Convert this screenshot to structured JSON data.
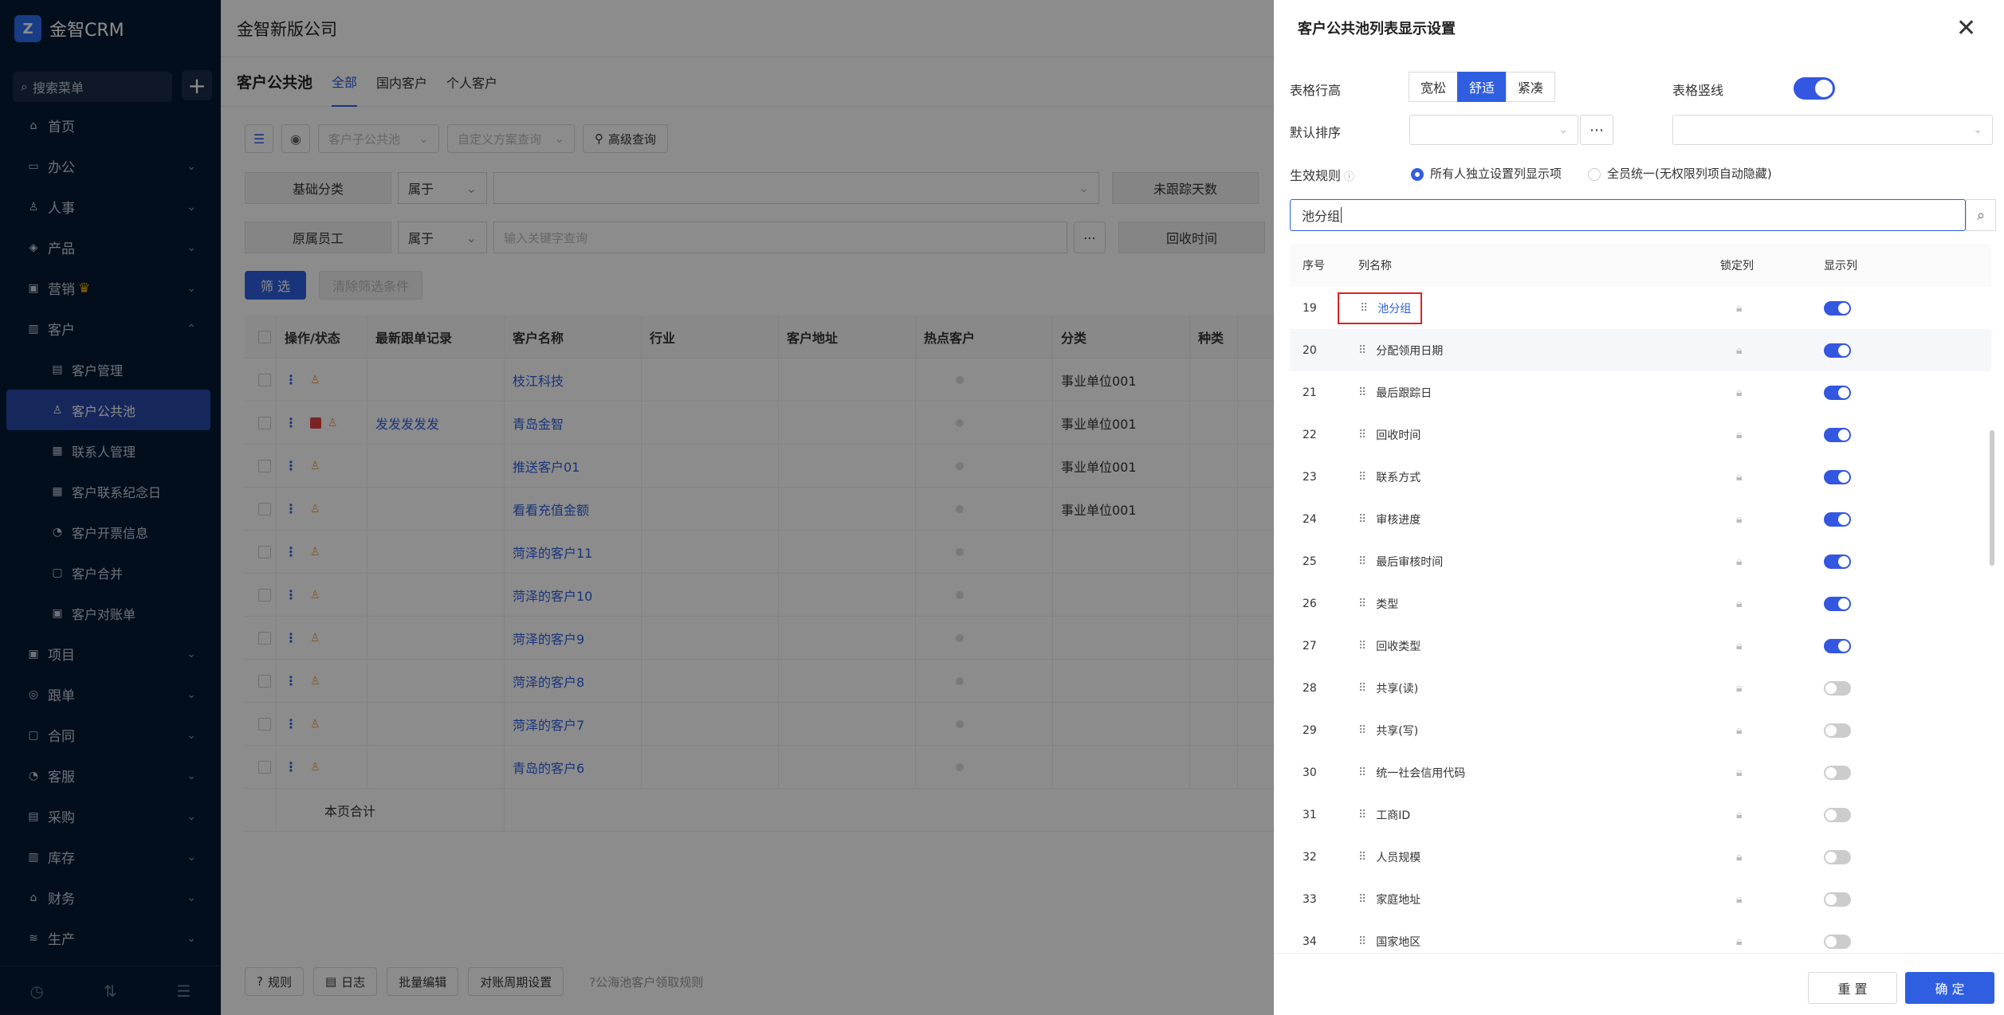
{
  "app": {
    "logo_text": "金智CRM",
    "search_placeholder": "搜索菜单",
    "plus": "+"
  },
  "sidebar": {
    "items": [
      {
        "label": "首页",
        "icon": "home-icon",
        "sub": false,
        "chev": ""
      },
      {
        "label": "办公",
        "icon": "office-icon",
        "sub": false,
        "chev": "⌄"
      },
      {
        "label": "人事",
        "icon": "people-icon",
        "sub": false,
        "chev": "⌄"
      },
      {
        "label": "产品",
        "icon": "product-icon",
        "sub": false,
        "chev": "⌄"
      },
      {
        "label": "营销",
        "icon": "marketing-icon",
        "sub": false,
        "chev": "⌄",
        "crown": "♛"
      },
      {
        "label": "客户",
        "icon": "customer-icon",
        "sub": false,
        "chev": "⌃"
      },
      {
        "label": "客户管理",
        "icon": "customer-manage-icon",
        "sub": true,
        "chev": ""
      },
      {
        "label": "客户公共池",
        "icon": "public-pool-icon",
        "sub": true,
        "chev": "",
        "active": true
      },
      {
        "label": "联系人管理",
        "icon": "contacts-icon",
        "sub": true,
        "chev": ""
      },
      {
        "label": "客户联系纪念日",
        "icon": "calendar-icon",
        "sub": true,
        "chev": ""
      },
      {
        "label": "客户开票信息",
        "icon": "invoice-icon",
        "sub": true,
        "chev": ""
      },
      {
        "label": "客户合并",
        "icon": "merge-icon",
        "sub": true,
        "chev": ""
      },
      {
        "label": "客户对账单",
        "icon": "statement-icon",
        "sub": true,
        "chev": ""
      },
      {
        "label": "项目",
        "icon": "project-icon",
        "sub": false,
        "chev": "⌄"
      },
      {
        "label": "跟单",
        "icon": "follow-icon",
        "sub": false,
        "chev": "⌄"
      },
      {
        "label": "合同",
        "icon": "contract-icon",
        "sub": false,
        "chev": "⌄"
      },
      {
        "label": "客服",
        "icon": "service-icon",
        "sub": false,
        "chev": "⌄"
      },
      {
        "label": "采购",
        "icon": "purchase-icon",
        "sub": false,
        "chev": "⌄"
      },
      {
        "label": "库存",
        "icon": "inventory-icon",
        "sub": false,
        "chev": "⌄"
      },
      {
        "label": "财务",
        "icon": "finance-icon",
        "sub": false,
        "chev": "⌄"
      },
      {
        "label": "生产",
        "icon": "production-icon",
        "sub": false,
        "chev": "⌄"
      }
    ]
  },
  "main": {
    "company": "金智新版公司",
    "page_title": "客户公共池",
    "tabs": [
      "全部",
      "国内客户",
      "个人客户"
    ],
    "toolbar": {
      "sub_pool_placeholder": "客户子公共池",
      "scheme_placeholder": "自定义方案查询",
      "advanced_query": "高级查询"
    },
    "filters": [
      {
        "label": "基础分类",
        "op": "属于",
        "value_placeholder": "",
        "right_label": "未跟踪天数"
      },
      {
        "label": "原属员工",
        "op": "属于",
        "value_placeholder": "输入关键字查询",
        "right_label": "回收时间"
      }
    ],
    "filter_button": "筛 选",
    "clear_button": "清除筛选条件",
    "columns": [
      "操作/状态",
      "最新跟单记录",
      "客户名称",
      "行业",
      "客户地址",
      "热点客户",
      "分类",
      "种类"
    ],
    "rows": [
      {
        "record": "",
        "name": "枝江科技",
        "category": "事业单位001",
        "badge": false
      },
      {
        "record": "发发发发发",
        "name": "青岛金智",
        "category": "事业单位001",
        "badge": true
      },
      {
        "record": "",
        "name": "推送客户01",
        "category": "事业单位001",
        "badge": false
      },
      {
        "record": "",
        "name": "看看充值金额",
        "category": "事业单位001",
        "badge": false
      },
      {
        "record": "",
        "name": "菏泽的客户11",
        "category": "",
        "badge": false
      },
      {
        "record": "",
        "name": "菏泽的客户10",
        "category": "",
        "badge": false
      },
      {
        "record": "",
        "name": "菏泽的客户9",
        "category": "",
        "badge": false
      },
      {
        "record": "",
        "name": "菏泽的客户8",
        "category": "",
        "badge": false
      },
      {
        "record": "",
        "name": "菏泽的客户7",
        "category": "",
        "badge": false
      },
      {
        "record": "",
        "name": "青岛的客户6",
        "category": "",
        "badge": false
      }
    ],
    "page_total": "本页合计",
    "footer": {
      "rules": "规则",
      "log": "日志",
      "batch_edit": "批量编辑",
      "period": "对账周期设置",
      "pool_rule": "公海池客户领取规则"
    }
  },
  "drawer": {
    "title": "客户公共池列表显示设置",
    "row_height_label": "表格行高",
    "row_height_options": [
      "宽松",
      "舒适",
      "紧凑"
    ],
    "row_height_selected": "舒适",
    "vline_label": "表格竖线",
    "vline_on": true,
    "sort_label": "默认排序",
    "rule_label": "生效规则",
    "rule_options": [
      "所有人独立设置列显示项",
      "全员统一(无权限列项自动隐藏)"
    ],
    "search_value": "池分组",
    "table_headers": [
      "序号",
      "列名称",
      "锁定列",
      "显示列"
    ],
    "rows": [
      {
        "n": "19",
        "name": "池分组",
        "show": true,
        "highlight": true
      },
      {
        "n": "20",
        "name": "分配领用日期",
        "show": true
      },
      {
        "n": "21",
        "name": "最后跟踪日",
        "show": true
      },
      {
        "n": "22",
        "name": "回收时间",
        "show": true
      },
      {
        "n": "23",
        "name": "联系方式",
        "show": true
      },
      {
        "n": "24",
        "name": "审核进度",
        "show": true
      },
      {
        "n": "25",
        "name": "最后审核时间",
        "show": true
      },
      {
        "n": "26",
        "name": "类型",
        "show": true
      },
      {
        "n": "27",
        "name": "回收类型",
        "show": true
      },
      {
        "n": "28",
        "name": "共享(读)",
        "show": false
      },
      {
        "n": "29",
        "name": "共享(写)",
        "show": false
      },
      {
        "n": "30",
        "name": "统一社会信用代码",
        "show": false
      },
      {
        "n": "31",
        "name": "工商ID",
        "show": false
      },
      {
        "n": "32",
        "name": "人员规模",
        "show": false
      },
      {
        "n": "33",
        "name": "家庭地址",
        "show": false
      },
      {
        "n": "34",
        "name": "国家地区",
        "show": false
      }
    ],
    "reset": "重 置",
    "confirm": "确 定"
  }
}
